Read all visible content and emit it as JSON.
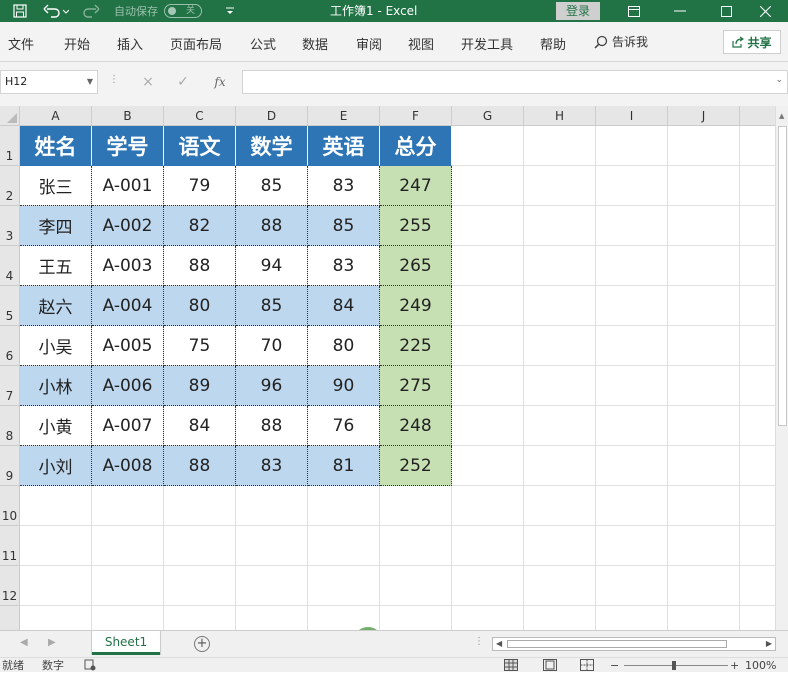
{
  "titlebar": {
    "autosave_label": "自动保存",
    "autosave_state": "关",
    "doc_title": "工作簿1  -  Excel",
    "login_label": "登录",
    "icons": [
      "save-icon",
      "undo-icon",
      "redo-icon",
      "customize-icon",
      "ribbon-display-icon",
      "minimize-icon",
      "maximize-icon",
      "close-icon"
    ],
    "accent": "#217346"
  },
  "ribbon": {
    "tabs": [
      "文件",
      "开始",
      "插入",
      "页面布局",
      "公式",
      "数据",
      "审阅",
      "视图",
      "开发工具",
      "帮助"
    ],
    "tell_me": "告诉我",
    "share": "共享"
  },
  "formula_bar": {
    "name_box": "H12",
    "cancel_icon": "×",
    "enter_icon": "✓",
    "fx_label": "fx",
    "formula": ""
  },
  "columns": [
    "A",
    "B",
    "C",
    "D",
    "E",
    "F",
    "G",
    "H",
    "I",
    "J"
  ],
  "rows": [
    "1",
    "2",
    "3",
    "4",
    "5",
    "6",
    "7",
    "8",
    "9",
    "10",
    "11",
    "12"
  ],
  "table": {
    "headers": [
      "姓名",
      "学号",
      "语文",
      "数学",
      "英语",
      "总分"
    ],
    "rows": [
      [
        "张三",
        "A-001",
        "79",
        "85",
        "83",
        "247"
      ],
      [
        "李四",
        "A-002",
        "82",
        "88",
        "85",
        "255"
      ],
      [
        "王五",
        "A-003",
        "88",
        "94",
        "83",
        "265"
      ],
      [
        "赵六",
        "A-004",
        "80",
        "85",
        "84",
        "249"
      ],
      [
        "小吴",
        "A-005",
        "75",
        "70",
        "80",
        "225"
      ],
      [
        "小林",
        "A-006",
        "89",
        "96",
        "90",
        "275"
      ],
      [
        "小黄",
        "A-007",
        "84",
        "88",
        "76",
        "248"
      ],
      [
        "小刘",
        "A-008",
        "88",
        "83",
        "81",
        "252"
      ]
    ],
    "colors": {
      "header": "#2e75b6",
      "band": "#bdd7ee",
      "total": "#c6e0b4"
    }
  },
  "sheets": {
    "tabs": [
      "Sheet1"
    ],
    "add_label": "+"
  },
  "statusbar": {
    "ready": "就绪",
    "mode": "数字",
    "zoom": "100%"
  }
}
